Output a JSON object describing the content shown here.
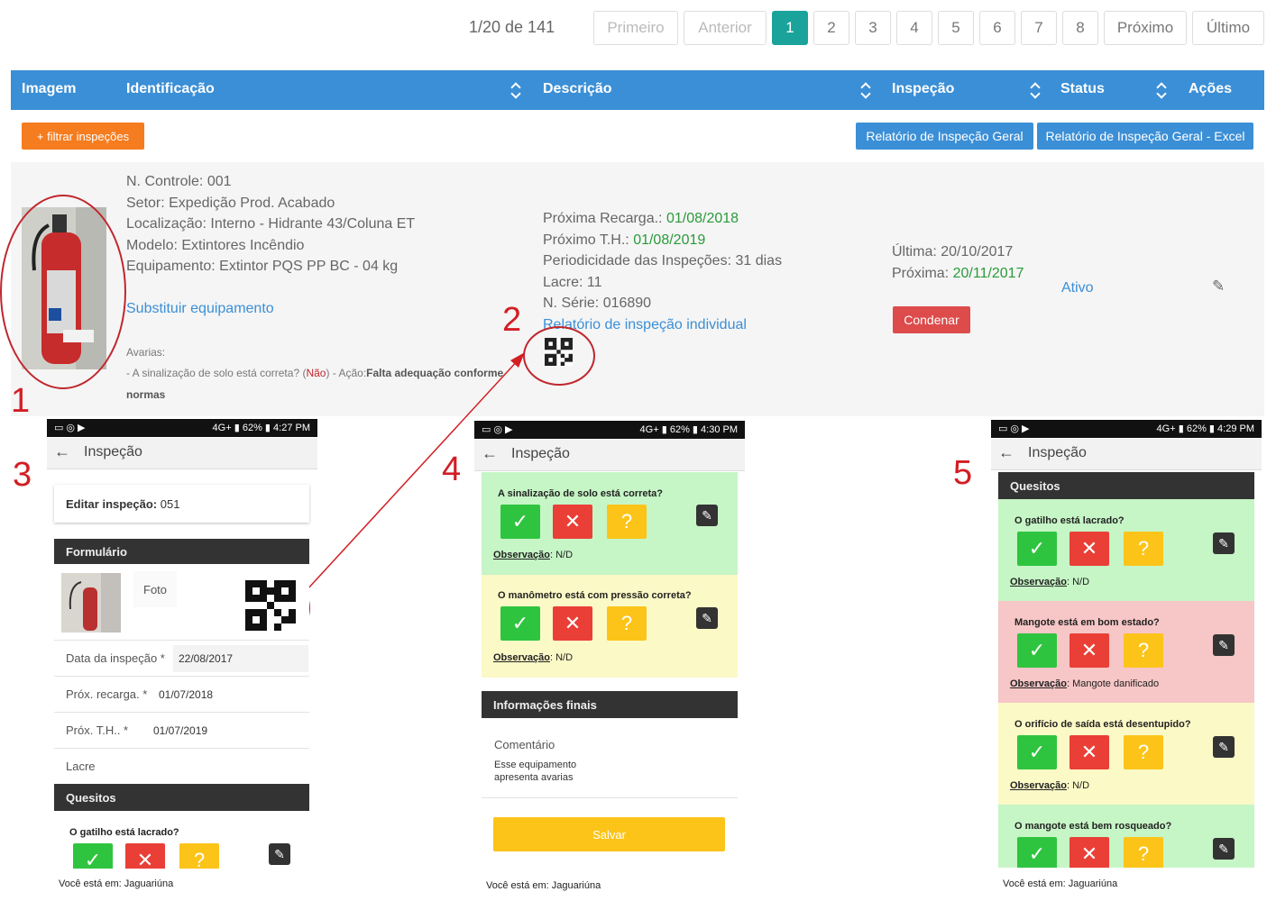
{
  "pagination": {
    "info": "1/20 de 141",
    "first": "Primeiro",
    "prev": "Anterior",
    "pages": [
      "1",
      "2",
      "3",
      "4",
      "5",
      "6",
      "7",
      "8"
    ],
    "next": "Próximo",
    "last": "Último"
  },
  "table": {
    "headers": [
      "Imagem",
      "Identificação",
      "Descrição",
      "Inspeção",
      "Status",
      "Ações"
    ]
  },
  "toolbar": {
    "filter": "+ filtrar inspeções",
    "report_general": "Relatório de Inspeção Geral",
    "report_excel": "Relatório de Inspeção Geral - Excel"
  },
  "row": {
    "identification": [
      "N. Controle: 001",
      "Setor: Expedição Prod. Acabado",
      "Localização: Interno - Hidrante 43/Coluna ET",
      "Modelo: Extintores Incêndio",
      "Equipamento: Extintor PQS PP BC - 04 kg"
    ],
    "replace_link": "Substituir equipamento",
    "avarias_label": "Avarias:",
    "avarias_pre": "- A sinalização de solo está correta? (",
    "avarias_no": "Não",
    "avarias_mid": ") - Ação:",
    "avarias_action": "Falta adequação conforme",
    "avarias_end": "normas",
    "desc": {
      "recarga_label": "Próxima Recarga.:",
      "recarga_value": "01/08/2018",
      "th_label": "Próximo T.H.:",
      "th_value": "01/08/2019",
      "periodicity": "Periodicidade das Inspeções: 31 dias",
      "lacre": "Lacre: 11",
      "serie": "N. Série: 016890",
      "report_link": "Relatório de inspeção individual"
    },
    "inspection": {
      "last": "Última: 20/10/2017",
      "next_label": "Próxima:",
      "next_value": "20/11/2017",
      "condemn": "Condenar"
    },
    "status": "Ativo"
  },
  "annotations": [
    "1",
    "2",
    "3",
    "4",
    "5"
  ],
  "phone_common": {
    "time3": "4:27 PM",
    "time4": "4:30 PM",
    "time5": "4:29 PM",
    "battery": "62%",
    "signal": "4G+",
    "title": "Inspeção",
    "footer": "Você está em: Jaguariúna",
    "obs_label": "Observação",
    "yes": "✓",
    "no": "✕",
    "unknown": "?"
  },
  "phone3": {
    "edit_label": "Editar inspeção:",
    "edit_value": " 051",
    "form_header": "Formulário",
    "photo_label": "Foto",
    "fields": [
      {
        "label": "Data da inspeção *",
        "value": "22/08/2017"
      },
      {
        "label": "Próx. recarga. *",
        "value": "01/07/2018"
      },
      {
        "label": "Próx. T.H.. *",
        "value": "01/07/2019"
      },
      {
        "label": "Lacre",
        "value": ""
      }
    ],
    "quesitos_header": "Quesitos",
    "question": "O gatilho está lacrado?"
  },
  "phone4": {
    "questions": [
      {
        "q": "A sinalização de solo está correta?",
        "obs": ": N/D"
      },
      {
        "q": "O manômetro está com pressão correta?",
        "obs": ": N/D"
      }
    ],
    "final_header": "Informações finais",
    "comment_label": "Comentário",
    "comment_value": "Esse equipamento apresenta avarias",
    "save": "Salvar"
  },
  "phone5": {
    "quesitos_header": "Quesitos",
    "questions": [
      {
        "q": "O gatilho está lacrado?",
        "obs": ": N/D"
      },
      {
        "q": "Mangote está em bom estado?",
        "obs": ": Mangote danificado"
      },
      {
        "q": "O orifício de saída está desentupido?",
        "obs": ": N/D"
      },
      {
        "q": "O mangote está bem rosqueado?",
        "obs": ""
      }
    ]
  },
  "colors": {
    "header_blue": "#3b8fd6",
    "active_page": "#1aa39a",
    "orange": "#f57c1f",
    "condemn_red": "#dd4b4b",
    "annotation_red": "#d21e24",
    "date_green": "#2a9a3a"
  }
}
